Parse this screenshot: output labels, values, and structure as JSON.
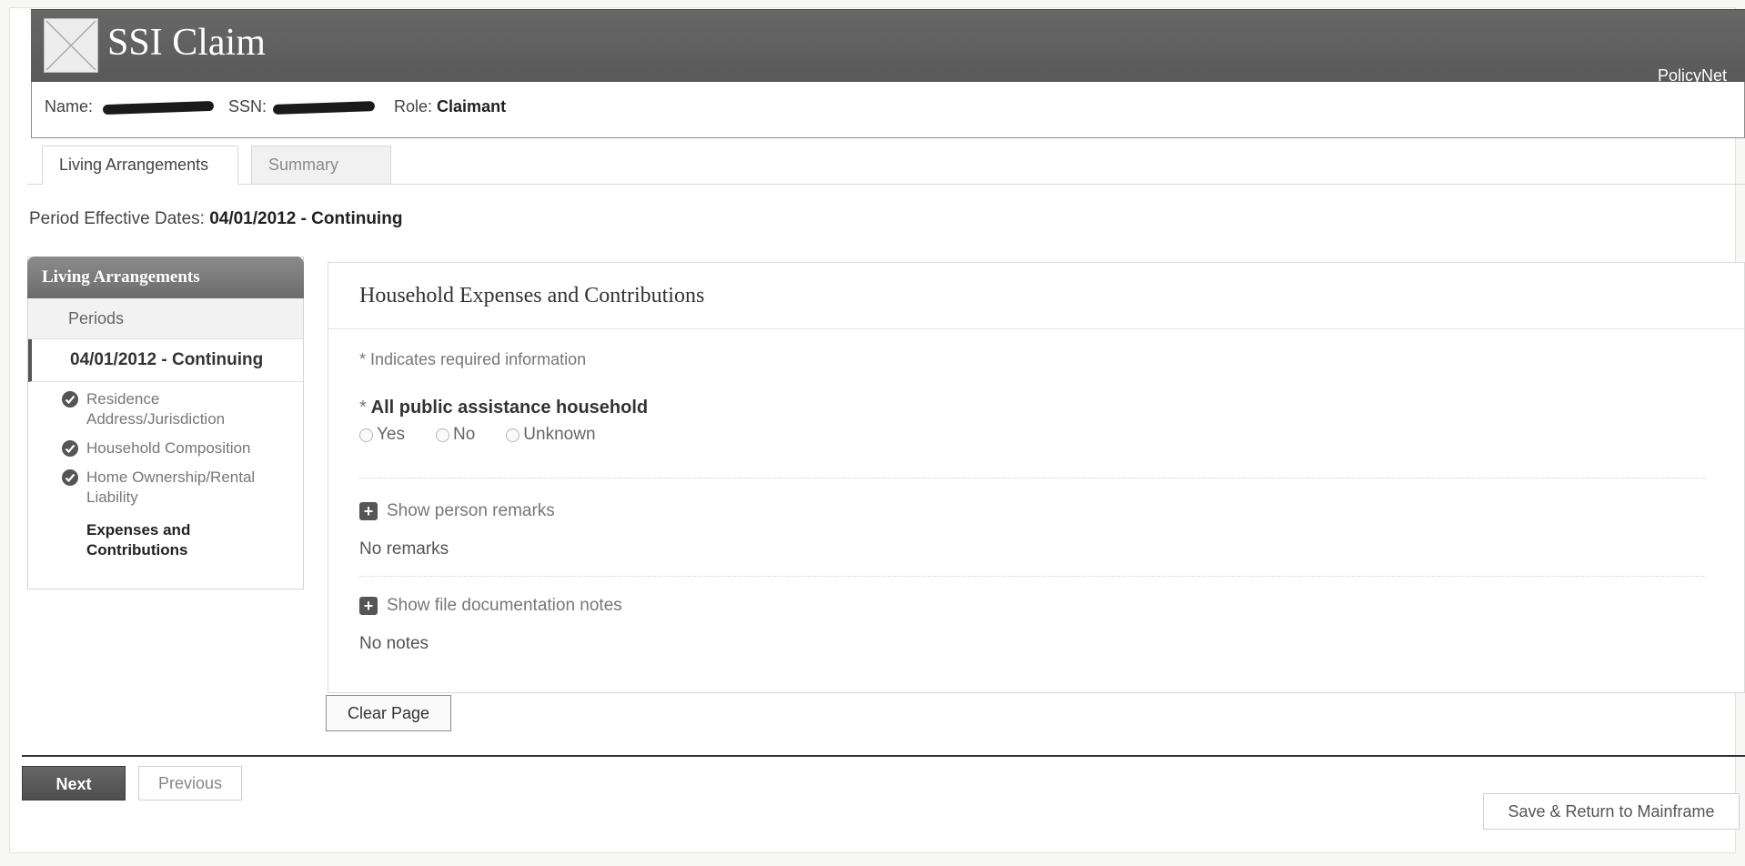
{
  "header": {
    "app_title": "SSI Claim",
    "brand_link": "PolicyNet",
    "logo_icon": "broken-image-icon"
  },
  "claimant": {
    "name_label": "Name:",
    "ssn_label": "SSN:",
    "role_label": "Role:",
    "role_value": "Claimant"
  },
  "tabs": [
    {
      "label": "Living Arrangements",
      "active": true
    },
    {
      "label": "Summary",
      "active": false
    }
  ],
  "period": {
    "label": "Period Effective Dates:",
    "value": "04/01/2012 - Continuing"
  },
  "left_nav": {
    "title": "Living Arrangements",
    "periods_label": "Periods",
    "current_period": "04/01/2012 - Continuing",
    "items": [
      {
        "label": "Residence Address/Jurisdiction",
        "completed": true
      },
      {
        "label": "Household Composition",
        "completed": true
      },
      {
        "label": "Home Ownership/Rental Liability",
        "completed": true
      },
      {
        "label": "Expenses and Contributions",
        "completed": false,
        "current": true
      }
    ]
  },
  "panel": {
    "title": "Household Expenses and Contributions",
    "required_note": "* Indicates required information",
    "question": {
      "asterisk": "*",
      "label": "All public assistance household",
      "options": [
        "Yes",
        "No",
        "Unknown"
      ]
    },
    "person_remarks": {
      "toggle_label": "Show person remarks",
      "value": "No remarks"
    },
    "file_notes": {
      "toggle_label": "Show file documentation notes",
      "value": "No notes"
    }
  },
  "buttons": {
    "clear_page": "Clear Page",
    "next": "Next",
    "previous": "Previous",
    "save_return": "Save & Return to Mainframe"
  },
  "colors": {
    "header_bg": "#5f5f5f",
    "nav_header_bg": "#7a7a7a",
    "next_button_bg": "#555555"
  }
}
